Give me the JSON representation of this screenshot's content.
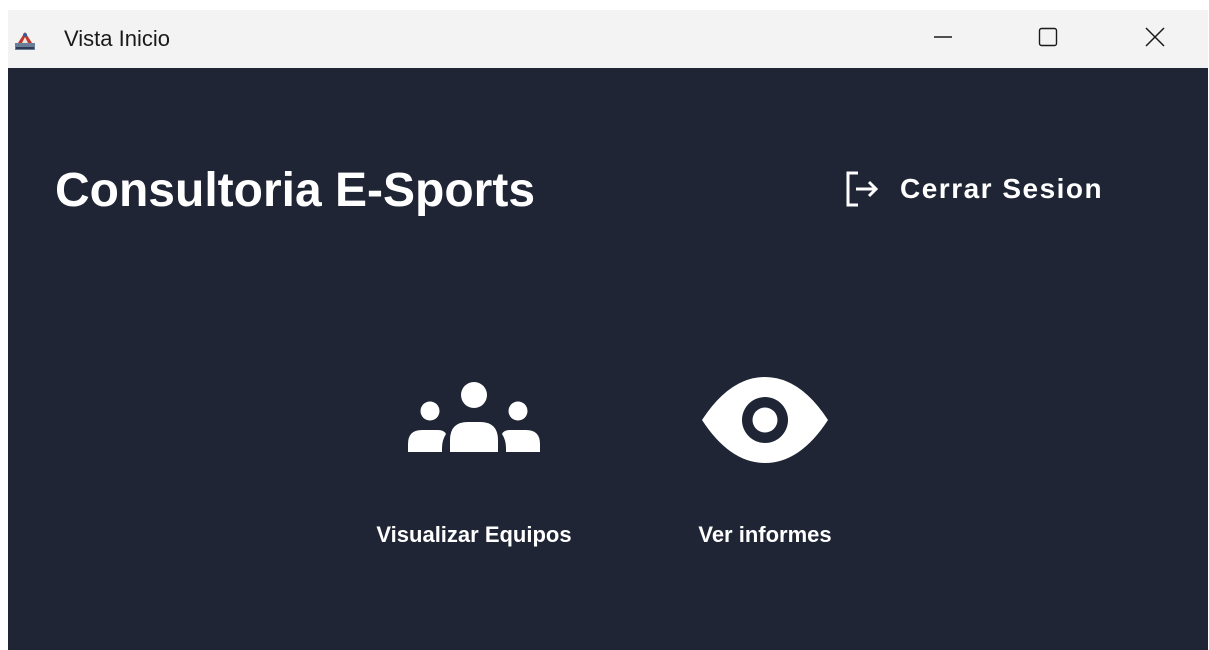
{
  "window": {
    "title": "Vista Inicio",
    "app_icon": "java-app-icon",
    "controls": {
      "minimize_icon": "minimize-icon",
      "maximize_icon": "maximize-icon",
      "close_icon": "close-icon"
    }
  },
  "header": {
    "brand": "Consultoria E-Sports",
    "logout_label": "Cerrar Sesion",
    "logout_icon": "logout-icon"
  },
  "actions": [
    {
      "label": "Visualizar Equipos",
      "icon": "team-icon"
    },
    {
      "label": "Ver informes",
      "icon": "eye-icon"
    }
  ],
  "colors": {
    "background": "#1f2535",
    "titlebar": "#f3f3f3",
    "text": "#ffffff"
  }
}
